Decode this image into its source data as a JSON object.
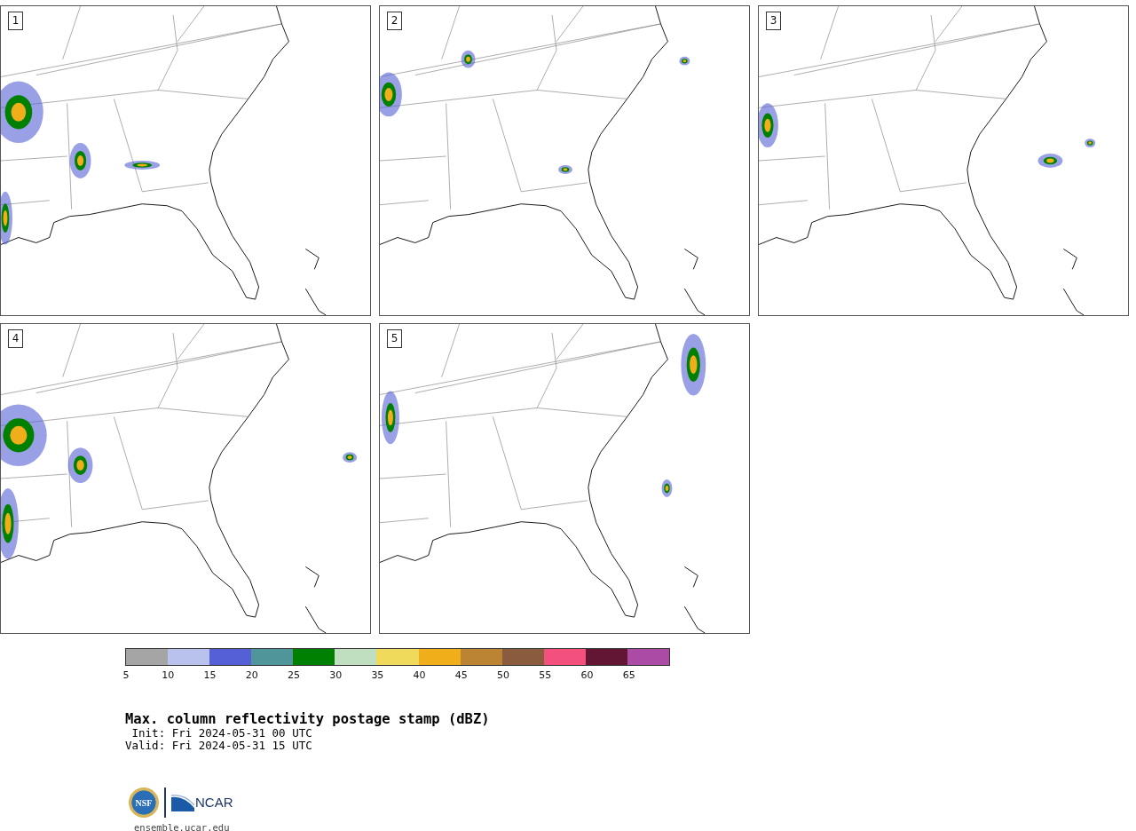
{
  "panels": [
    {
      "label": "1"
    },
    {
      "label": "2"
    },
    {
      "label": "3"
    },
    {
      "label": "4"
    },
    {
      "label": "5"
    }
  ],
  "colorbar": {
    "bins": [
      {
        "color": "#a5a5a5"
      },
      {
        "color": "#b8c2ec"
      },
      {
        "color": "#5560d6"
      },
      {
        "color": "#4f9599"
      },
      {
        "color": "#008000"
      },
      {
        "color": "#bfdfc0"
      },
      {
        "color": "#f0da5c"
      },
      {
        "color": "#f0ae1a"
      },
      {
        "color": "#bb8432"
      },
      {
        "color": "#8b5b3e"
      },
      {
        "color": "#f4507e"
      },
      {
        "color": "#621634"
      },
      {
        "color": "#ab4ba5"
      }
    ],
    "ticks": [
      "5",
      "10",
      "15",
      "20",
      "25",
      "30",
      "35",
      "40",
      "45",
      "50",
      "55",
      "60",
      "65"
    ]
  },
  "title": "Max. column reflectivity postage stamp (dBZ)",
  "init": " Init: Fri 2024-05-31 00 UTC",
  "valid": "Valid: Fri 2024-05-31 15 UTC",
  "logos": {
    "nsf": "NSF",
    "ncar": "NCAR"
  },
  "footer": "ensemble.ucar.edu"
}
